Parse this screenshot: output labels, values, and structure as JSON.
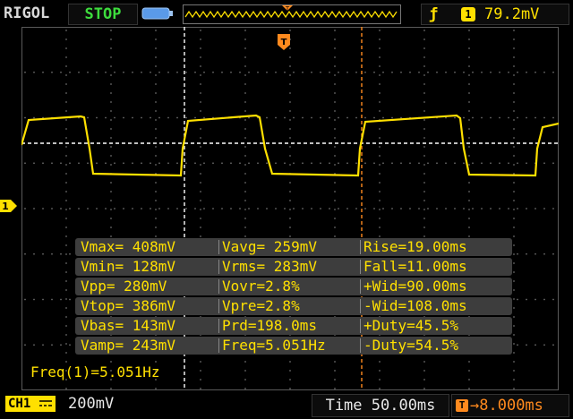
{
  "brand": "RIGOL",
  "run_status": "STOP",
  "trigger": {
    "edge_symbol": "ƒ",
    "channel": "1",
    "level": "79.2mV",
    "marker_label": "T"
  },
  "channel_marker": "1",
  "measurements": [
    [
      "Vmax= 408mV",
      "Vavg= 259mV",
      "Rise=19.00ms"
    ],
    [
      "Vmin= 128mV",
      "Vrms= 283mV",
      "Fall=11.00ms"
    ],
    [
      "Vpp= 280mV",
      "Vovr=2.8%",
      "+Wid=90.00ms"
    ],
    [
      "Vtop= 386mV",
      "Vpre=2.8%",
      "-Wid=108.0ms"
    ],
    [
      "Vbas= 143mV",
      "Prd=198.0ms",
      "+Duty=45.5%"
    ],
    [
      "Vamp= 243mV",
      "Freq=5.051Hz",
      "-Duty=54.5%"
    ]
  ],
  "frequency_counter": "Freq(1)=5.051Hz",
  "bottom": {
    "channel_label": "CH1",
    "vertical_scale": "200mV",
    "timebase": "Time 50.00ms",
    "trigger_delay": "8.000ms"
  },
  "colors": {
    "trace": "#ffe000",
    "trigger_marker": "#ff8a1e",
    "status_stop": "#3ddc3d",
    "grid_dots": "#6a6a6a"
  },
  "icons": [
    "battery-icon",
    "trigger-edge-icon",
    "trigger-position-icon",
    "channel-1-marker-icon",
    "coupling-icon"
  ]
}
